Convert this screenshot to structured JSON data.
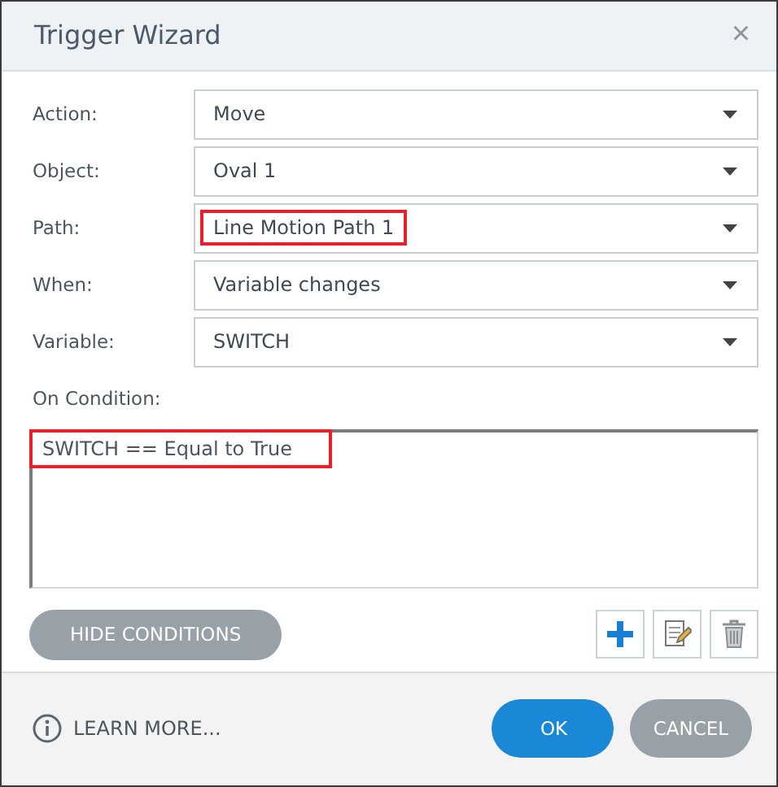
{
  "window": {
    "title": "Trigger Wizard",
    "close": "×"
  },
  "fields": [
    {
      "label": "Action:",
      "value": "Move",
      "highlighted": false
    },
    {
      "label": "Object:",
      "value": "Oval 1",
      "highlighted": false
    },
    {
      "label": "Path:",
      "value": "Line Motion Path 1",
      "highlighted": true
    },
    {
      "label": "When:",
      "value": "Variable changes",
      "highlighted": false
    },
    {
      "label": "Variable:",
      "value": "SWITCH",
      "highlighted": false
    }
  ],
  "conditions": {
    "label": "On Condition:",
    "items": [
      {
        "text": "SWITCH == Equal to True",
        "highlighted": true
      }
    ]
  },
  "hide_button": "HIDE CONDITIONS",
  "footer": {
    "link": "LEARN MORE...",
    "ok": "OK",
    "cancel": "CANCEL"
  }
}
